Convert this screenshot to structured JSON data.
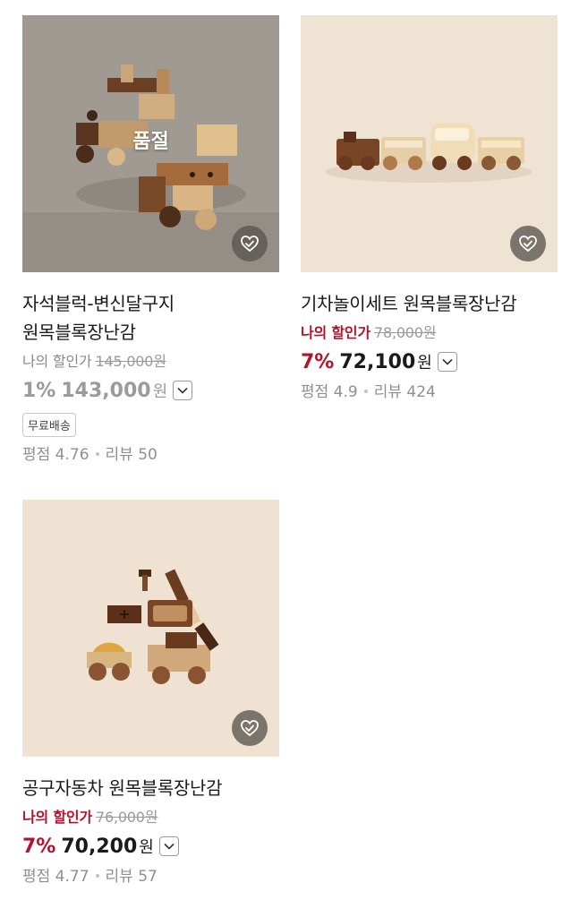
{
  "products": [
    {
      "title_line1": "자석블럭-변신달구지",
      "title_line2": "원목블록장난감",
      "sold_out_label": "품절",
      "my_price_label": "나의 할인가",
      "original_price": "145,000원",
      "discount_rate": "1%",
      "price": "143,000",
      "currency": "원",
      "badge": "무료배송",
      "rating_label": "평점 4.76",
      "review_label": "리뷰 50"
    },
    {
      "title_line1": "기차놀이세트 원목블록장난감",
      "my_price_label": "나의 할인가",
      "original_price": "78,000원",
      "discount_rate": "7%",
      "price": "72,100",
      "currency": "원",
      "rating_label": "평점 4.9",
      "review_label": "리뷰 424"
    },
    {
      "title_line1": "공구자동차 원목블록장난감",
      "my_price_label": "나의 할인가",
      "original_price": "76,000원",
      "discount_rate": "7%",
      "price": "70,200",
      "currency": "원",
      "rating_label": "평점 4.77",
      "review_label": "리뷰 57"
    }
  ],
  "colors": {
    "accent_red": "#b5122e",
    "muted_gray": "#9b9b9b"
  }
}
